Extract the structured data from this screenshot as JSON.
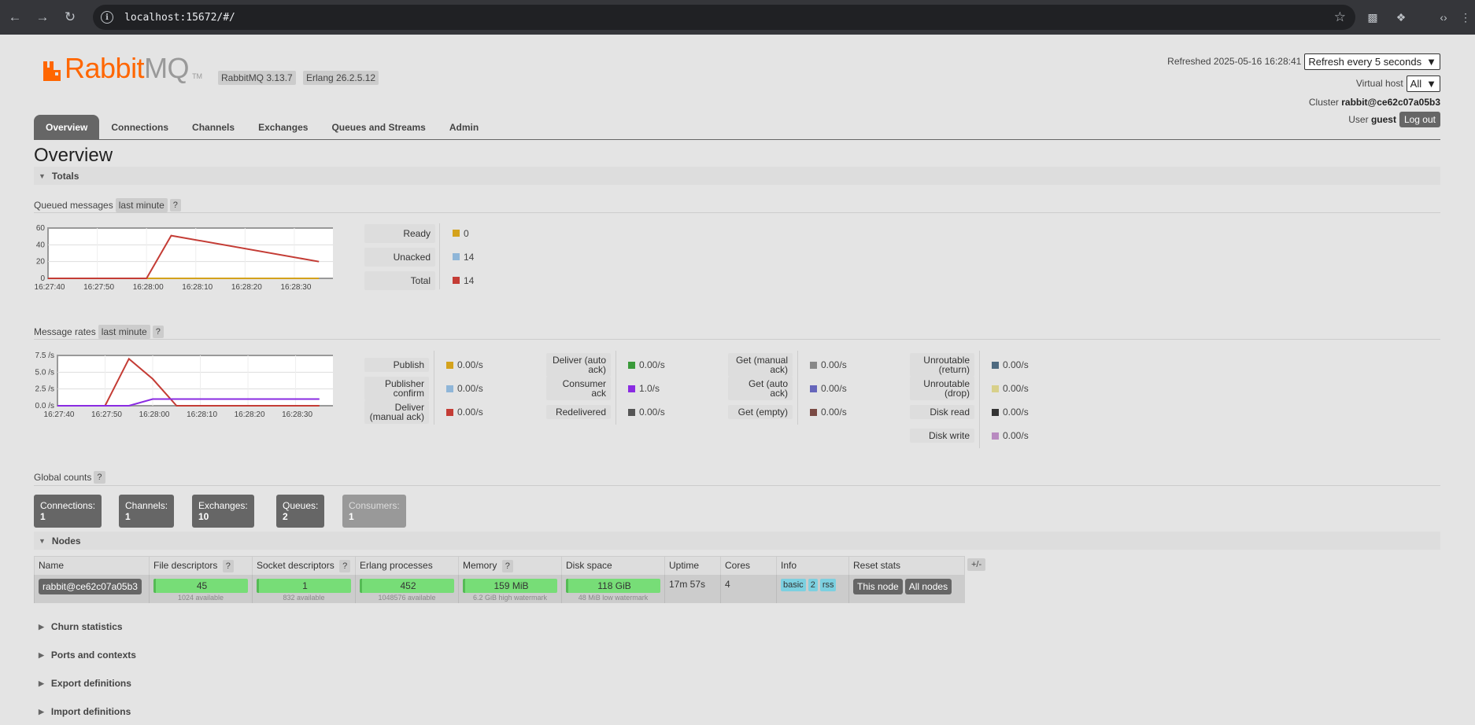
{
  "browser": {
    "url": "localhost:15672/#/"
  },
  "header": {
    "logo_rabbit": "Rabbit",
    "logo_mq": "MQ",
    "logo_tm": "TM",
    "rabbitmq_version": "RabbitMQ 3.13.7",
    "erlang_version": "Erlang 26.2.5.12",
    "refreshed_label": "Refreshed",
    "refreshed_time": "2025-05-16 16:28:41",
    "refresh_option": "Refresh every 5 seconds",
    "vhost_label": "Virtual host",
    "vhost_value": "All",
    "cluster_label": "Cluster",
    "cluster_value": "rabbit@ce62c07a05b3",
    "user_label": "User",
    "user_value": "guest",
    "logout_label": "Log out"
  },
  "tabs": [
    "Overview",
    "Connections",
    "Channels",
    "Exchanges",
    "Queues and Streams",
    "Admin"
  ],
  "page_title": "Overview",
  "totals": {
    "header": "Totals",
    "queued_label": "Queued messages",
    "queued_range": "last minute",
    "help": "?",
    "queued_stats": [
      {
        "label": "Ready",
        "value": "0",
        "color": "#d4a21c"
      },
      {
        "label": "Unacked",
        "value": "14",
        "color": "#8fb6d8"
      },
      {
        "label": "Total",
        "value": "14",
        "color": "#c43c35"
      }
    ],
    "rates_label": "Message rates",
    "rates_range": "last minute",
    "rate_cols": [
      [
        {
          "label": "Publish",
          "value": "0.00/s",
          "color": "#d4a21c"
        },
        {
          "label": "Publisher confirm",
          "value": "0.00/s",
          "color": "#8fb6d8"
        },
        {
          "label": "Deliver (manual ack)",
          "value": "0.00/s",
          "color": "#c43c35"
        }
      ],
      [
        {
          "label": "Deliver (auto ack)",
          "value": "0.00/s",
          "color": "#3a9a3a"
        },
        {
          "label": "Consumer ack",
          "value": "1.0/s",
          "color": "#8a2be2"
        },
        {
          "label": "Redelivered",
          "value": "0.00/s",
          "color": "#555555"
        }
      ],
      [
        {
          "label": "Get (manual ack)",
          "value": "0.00/s",
          "color": "#888888"
        },
        {
          "label": "Get (auto ack)",
          "value": "0.00/s",
          "color": "#6666bb"
        },
        {
          "label": "Get (empty)",
          "value": "0.00/s",
          "color": "#7a4a44"
        }
      ],
      [
        {
          "label": "Unroutable (return)",
          "value": "0.00/s",
          "color": "#4e6a80"
        },
        {
          "label": "Unroutable (drop)",
          "value": "0.00/s",
          "color": "#d8d08a"
        },
        {
          "label": "Disk read",
          "value": "0.00/s",
          "color": "#333333"
        },
        {
          "label": "Disk write",
          "value": "0.00/s",
          "color": "#b88ac0"
        }
      ]
    ]
  },
  "chart_data": [
    {
      "type": "line",
      "x": [
        "16:27:40",
        "16:27:50",
        "16:28:00",
        "16:28:10",
        "16:28:20",
        "16:28:30"
      ],
      "ylim": [
        0,
        60
      ],
      "yticks": [
        "60",
        "40",
        "20",
        "0"
      ],
      "series": [
        {
          "name": "Ready",
          "color": "#d4a21c",
          "points": [
            [
              0,
              0
            ],
            [
              20,
              0
            ],
            [
              25,
              0
            ],
            [
              55,
              0
            ]
          ]
        },
        {
          "name": "Total",
          "color": "#c43c35",
          "points": [
            [
              0,
              0
            ],
            [
              20,
              0
            ],
            [
              25,
              51
            ],
            [
              55,
              20
            ]
          ]
        }
      ]
    },
    {
      "type": "line",
      "x": [
        "16:27:40",
        "16:27:50",
        "16:28:00",
        "16:28:10",
        "16:28:20",
        "16:28:30"
      ],
      "ylim": [
        0,
        7.5
      ],
      "yticks": [
        "7.5 /s",
        "5.0 /s",
        "2.5 /s",
        "0.0 /s"
      ],
      "series": [
        {
          "name": "Deliver (manual ack)",
          "color": "#c43c35",
          "points": [
            [
              0,
              0
            ],
            [
              10,
              0
            ],
            [
              15,
              7
            ],
            [
              20,
              4
            ],
            [
              25,
              0
            ],
            [
              55,
              0
            ]
          ]
        },
        {
          "name": "Consumer ack",
          "color": "#8a2be2",
          "points": [
            [
              0,
              0
            ],
            [
              15,
              0
            ],
            [
              20,
              1
            ],
            [
              55,
              1
            ]
          ]
        }
      ]
    }
  ],
  "global_counts": {
    "label": "Global counts",
    "items": [
      {
        "label": "Connections:",
        "value": "1",
        "muted": false
      },
      {
        "label": "Channels:",
        "value": "1",
        "muted": false
      },
      {
        "label": "Exchanges:",
        "value": "10",
        "muted": false
      },
      {
        "label": "Queues:",
        "value": "2",
        "muted": false
      },
      {
        "label": "Consumers:",
        "value": "1",
        "muted": true
      }
    ]
  },
  "nodes": {
    "header": "Nodes",
    "columns": [
      "Name",
      "File descriptors",
      "Socket descriptors",
      "Erlang processes",
      "Memory",
      "Disk space",
      "Uptime",
      "Cores",
      "Info",
      "Reset stats"
    ],
    "row": {
      "name": "rabbit@ce62c07a05b3",
      "fd": "45",
      "fd_sub": "1024 available",
      "sd": "1",
      "sd_sub": "832 available",
      "ep": "452",
      "ep_sub": "1048576 available",
      "mem": "159 MiB",
      "mem_sub": "6.2 GiB high watermark",
      "disk": "118 GiB",
      "disk_sub": "48 MiB low watermark",
      "uptime": "17m 57s",
      "cores": "4",
      "info": [
        "basic",
        "2",
        "rss"
      ],
      "reset_this": "This node",
      "reset_all": "All nodes"
    },
    "plusminus": "+/-"
  },
  "collapsed_sections": [
    "Churn statistics",
    "Ports and contexts",
    "Export definitions",
    "Import definitions"
  ]
}
